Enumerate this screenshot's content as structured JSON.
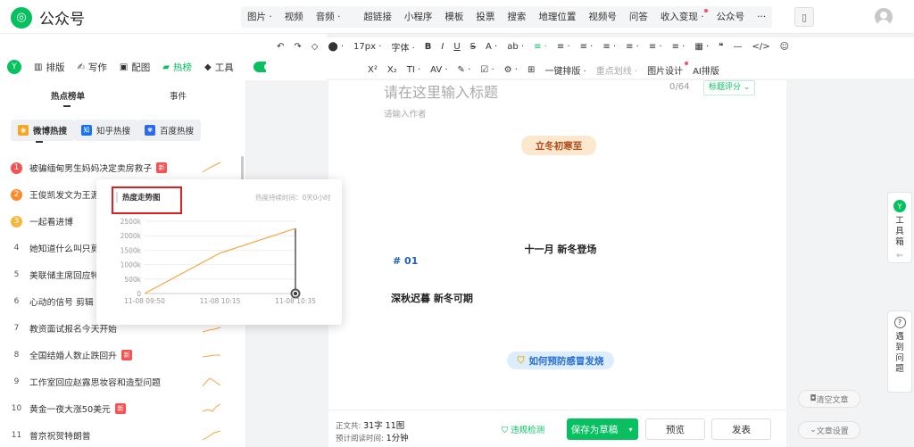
{
  "app": {
    "title": "公众号"
  },
  "top_menu": {
    "items": [
      "图片 ·",
      "视频",
      "音频 ·",
      "超链接",
      "小程序",
      "模板",
      "投票",
      "搜索",
      "地理位置",
      "视频号",
      "问答",
      "收入变现 ·",
      "公众号",
      "···"
    ]
  },
  "left_tabs": {
    "items": [
      {
        "label": "排版",
        "icon": "layout-icon"
      },
      {
        "label": "写作",
        "icon": "write-icon"
      },
      {
        "label": "配图",
        "icon": "image-icon"
      },
      {
        "label": "热榜",
        "icon": "hot-icon"
      },
      {
        "label": "工具",
        "icon": "tool-icon"
      }
    ]
  },
  "hot_panel": {
    "tabs": [
      "热点榜单",
      "事件"
    ],
    "sources": [
      "微博热搜",
      "知乎热搜",
      "百度热搜"
    ],
    "items": [
      {
        "rank": "1",
        "title": "被骗缅甸男生妈妈决定卖房救子",
        "badge": "新"
      },
      {
        "rank": "2",
        "title": "王俊凯发文为王源",
        "badge": ""
      },
      {
        "rank": "3",
        "title": "一起看进博",
        "badge": ""
      },
      {
        "rank": "4",
        "title": "她知道什么叫只剪",
        "badge": ""
      },
      {
        "rank": "5",
        "title": "美联储主席回应特",
        "badge": ""
      },
      {
        "rank": "6",
        "title": "心动的信号 剪辑",
        "badge": ""
      },
      {
        "rank": "7",
        "title": "教资面试报名今天开始",
        "badge": ""
      },
      {
        "rank": "8",
        "title": "全国结婚人数止跌回升",
        "badge": "新"
      },
      {
        "rank": "9",
        "title": "工作室回应赵露思妆容和造型问题",
        "badge": ""
      },
      {
        "rank": "10",
        "title": "黄金一夜大涨50美元",
        "badge": "新"
      },
      {
        "rank": "11",
        "title": "普京祝贺特朗普",
        "badge": ""
      }
    ],
    "rank_colors": [
      "#f65252",
      "#ff8a2b",
      "#f5b73b"
    ],
    "new_badge_color": "#fa5151"
  },
  "trend_popup": {
    "title": "热度走势图",
    "duration_label": "热度持续时间：",
    "duration_value": "0天0小时"
  },
  "chart_data": {
    "type": "line",
    "title": "热度走势图",
    "x": [
      "11-08 09:50",
      "11-08 10:15",
      "11-08 10:35"
    ],
    "series": [
      {
        "values": [
          0,
          1400000,
          2250000
        ]
      }
    ],
    "x_tick_labels": [
      "11-08 09:50",
      "11-08 10:15",
      "11-08 10:35"
    ],
    "y_tick_labels": [
      "0",
      "500k",
      "1000k",
      "1500k",
      "2000k",
      "2500k"
    ],
    "ylim": [
      0,
      2500000
    ],
    "grid": true,
    "line_color": "#f8a43c"
  },
  "toolbar": {
    "row1": [
      "17px ·",
      "字体 ·",
      "B",
      "I",
      "U",
      "S",
      "A ·",
      "ab ·",
      "≡ ·",
      "≡ ·",
      "≡ ·",
      "≡ ·",
      "≡ ·",
      "≡ ·",
      "≡ ·",
      "▦ ·",
      "❝",
      "—",
      "</>",
      "☺"
    ],
    "row2": [
      "X²",
      "X₂",
      "TI ·",
      "AV ·",
      "✎ ·",
      "☑ ·",
      "⚙ ·",
      "⊞",
      "一键排版 ·",
      "重点划线 ·",
      "图片设计",
      "AI排版"
    ]
  },
  "editor": {
    "title_placeholder": "请在这里输入标题",
    "title_count": "0/64",
    "score_button": "标题评分 ⌄",
    "author_placeholder": "请输入作者",
    "banners": {
      "b1": "立冬初寒至",
      "b2": "十一月 新冬登场",
      "b3_num": "# 01",
      "b3": "深秋迟暮 新冬可期",
      "b4": "如何预防感冒发烧"
    }
  },
  "footer": {
    "word_label": "正文共:",
    "word_value": "31字 11图",
    "time_label": "预计阅读时间:",
    "time_value": "1分钟",
    "violation_check": "违规检测",
    "save_draft": "保存为草稿",
    "preview": "预览",
    "publish": "发表"
  },
  "side": {
    "clear": "清空文章",
    "settings": "文章设置",
    "toolbox": "工具箱",
    "help": "遇到问题"
  }
}
